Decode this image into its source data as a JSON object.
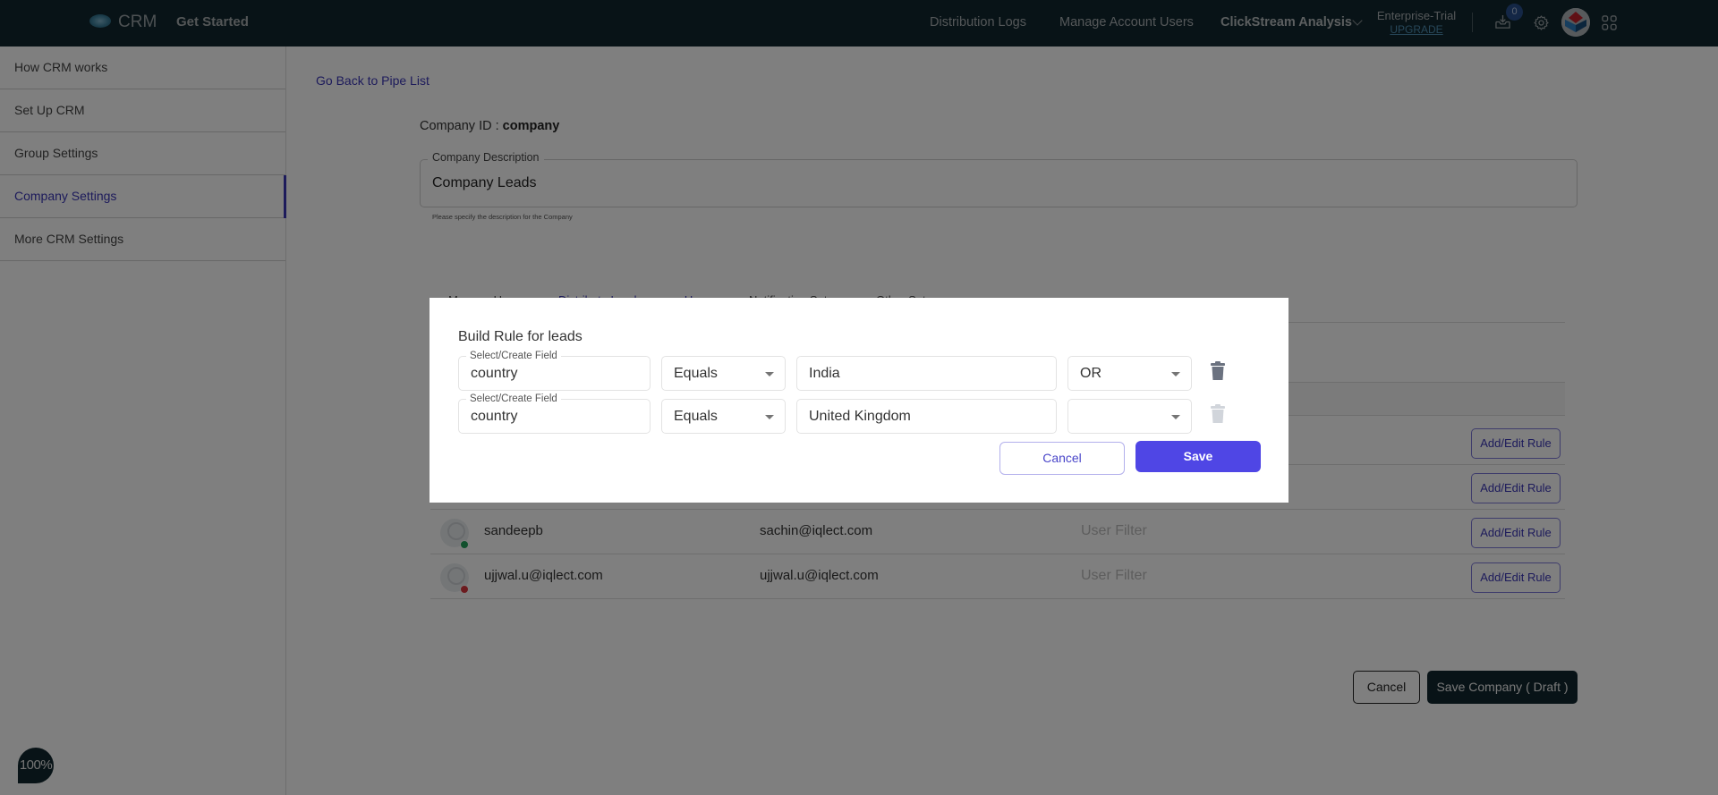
{
  "topbar": {
    "brand": "CRM",
    "get_started": "Get Started",
    "nav": [
      "Distribution Logs",
      "Manage Account Users",
      "ClickStream Analysis"
    ],
    "plan": "Enterprise-Trial",
    "upgrade": "UPGRADE",
    "notification_count": "0",
    "icons": [
      "logo-icon",
      "chevron-down-icon",
      "inbox-download-icon",
      "gear-icon",
      "profile-avatar",
      "apps-grid-icon"
    ]
  },
  "sidebar": {
    "items": [
      {
        "label": "How CRM works",
        "active": false
      },
      {
        "label": "Set Up CRM",
        "active": false
      },
      {
        "label": "Group Settings",
        "active": false
      },
      {
        "label": "Company Settings",
        "active": true
      },
      {
        "label": "More CRM Settings",
        "active": false
      }
    ]
  },
  "main": {
    "back_link": "Go Back to Pipe List",
    "company_id_label": "Company ID : ",
    "company_id_value": "company",
    "description": {
      "label": "Company Description",
      "value": "Company Leads",
      "help": "Please specify the description for the Company"
    },
    "tabs": [
      {
        "label": "Manage Users",
        "active": false
      },
      {
        "label": "Distribute Leads among Users",
        "active": true
      },
      {
        "label": "Notification Setup",
        "active": false
      },
      {
        "label": "Other Setup",
        "active": false
      }
    ],
    "users": [
      {
        "name": "",
        "email": "",
        "filter": "",
        "action": "Add/Edit Rule",
        "status": ""
      },
      {
        "name": "",
        "email": "",
        "filter": "",
        "action": "Add/Edit Rule",
        "status": ""
      },
      {
        "name": "sandeepb",
        "email": "sachin@iqlect.com",
        "filter": "User Filter",
        "action": "Add/Edit Rule",
        "status": "online"
      },
      {
        "name": "ujjwal.u@iqlect.com",
        "email": "ujjwal.u@iqlect.com",
        "filter": "User Filter",
        "action": "Add/Edit Rule",
        "status": "offline"
      }
    ],
    "footer": {
      "cancel": "Cancel",
      "save": "Save Company ( Draft )"
    },
    "zoom_level": "100%"
  },
  "modal": {
    "title": "Build Rule for leads",
    "rules": [
      {
        "field_label": "Select/Create Field",
        "field": "country",
        "operator": "Equals",
        "value": "India",
        "joiner": "OR",
        "delete_enabled": true
      },
      {
        "field_label": "Select/Create Field",
        "field": "country",
        "operator": "Equals",
        "value": "United Kingdom",
        "joiner": "",
        "delete_enabled": false
      }
    ],
    "cancel": "Cancel",
    "save": "Save"
  },
  "colors": {
    "topbar_bg": "#11272e",
    "accent": "#3b36b7",
    "primary_button": "#4f46e5",
    "online": "#22a05a",
    "offline": "#d9363e"
  }
}
